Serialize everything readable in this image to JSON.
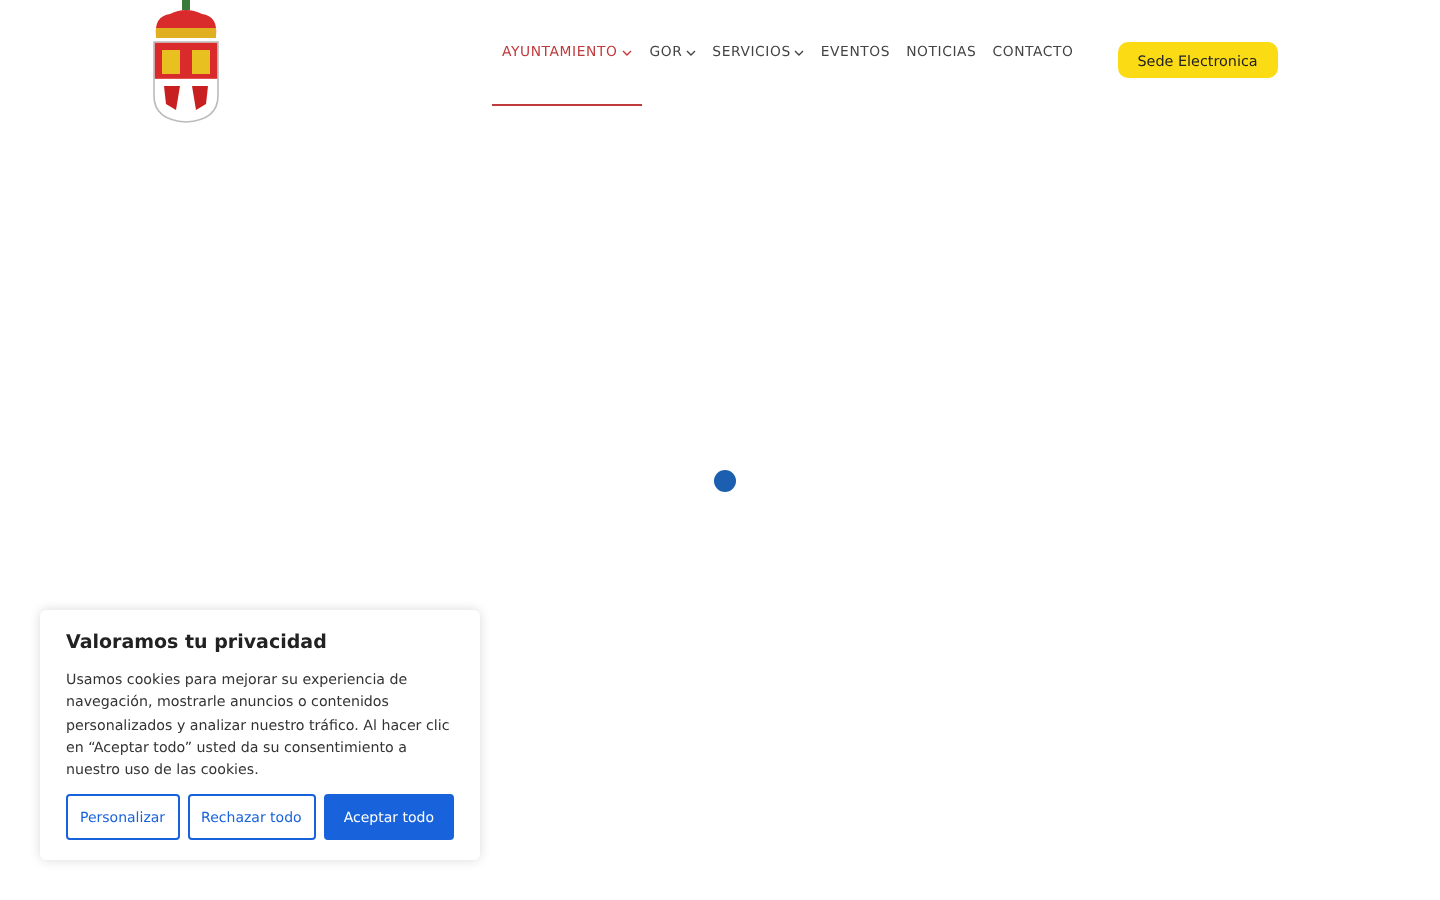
{
  "nav": {
    "items": [
      {
        "label": "AYUNTAMIENTO",
        "selected": true,
        "dropdown": true
      },
      {
        "label": "GOR",
        "selected": false,
        "dropdown": true
      },
      {
        "label": "SERVICIOS",
        "selected": false,
        "dropdown": true
      },
      {
        "label": "EVENTOS",
        "selected": false,
        "dropdown": false
      },
      {
        "label": "NOTICIAS",
        "selected": false,
        "dropdown": false
      },
      {
        "label": "CONTACTO",
        "selected": false,
        "dropdown": false
      }
    ],
    "cta": "Sede Electronica"
  },
  "cookie_banner": {
    "title": "Valoramos tu privacidad",
    "text": "Usamos cookies para mejorar su experiencia de navegación, mostrarle anuncios o contenidos personalizados y analizar nuestro tráfico. Al hacer clic en “Aceptar todo” usted da su consentimiento a nuestro uso de las cookies.",
    "buttons": [
      {
        "label": "Personalizar",
        "kind": "outline"
      },
      {
        "label": "Rechazar todo",
        "kind": "outline"
      },
      {
        "label": "Aceptar todo",
        "kind": "primary"
      }
    ]
  }
}
